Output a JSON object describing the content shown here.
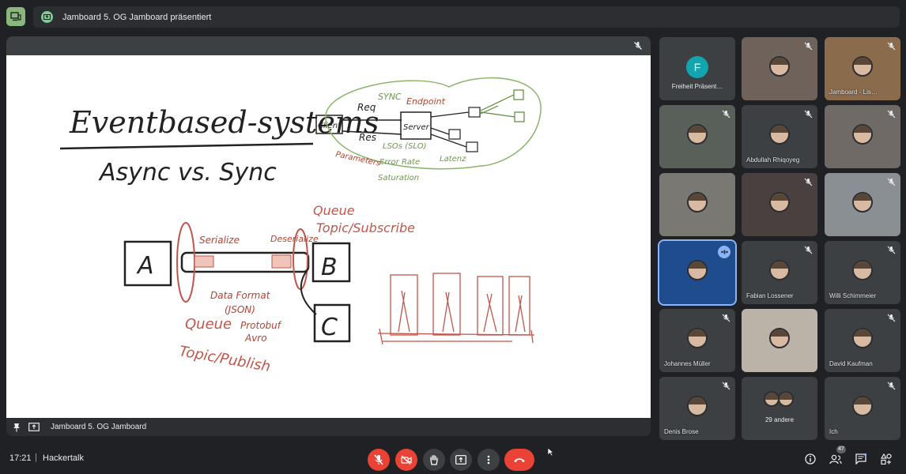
{
  "banner": {
    "text": "Jamboard 5. OG Jamboard präsentiert"
  },
  "presentation": {
    "footer_text": "Jamboard 5. OG Jamboard",
    "whiteboard": {
      "title": "Eventbased-systems",
      "subtitle": "Async vs. Sync",
      "client_label": "Client",
      "server_label": "Server",
      "req_label": "Req",
      "res_label": "Res",
      "sync_label": "SYNC",
      "endpoint_label": "Endpoint",
      "parameters_label": "Parameters",
      "metrics": [
        "LSOs (SLO)",
        "Latenz",
        "Error Rate",
        "Saturation"
      ],
      "box_a": "A",
      "box_b": "B",
      "box_c": "C",
      "serialize_label": "Serialize",
      "deserialize_label": "Deserialize",
      "queue_topic_sub": [
        "Queue",
        "Topic/Subscribe"
      ],
      "dataformat": [
        "Data Format",
        "(JSON)",
        "Protobuf",
        "Avro"
      ],
      "queue_topic_pub": [
        "Queue",
        "Topic/Publish"
      ]
    }
  },
  "participants": [
    {
      "id": "freiheit",
      "name": "Freiheit Präsent…",
      "avatar_letter": "F",
      "muted": false
    },
    {
      "id": "p2",
      "name": "",
      "muted": true
    },
    {
      "id": "jamboard-lis",
      "name": "Jamboard - Lis…",
      "muted": true
    },
    {
      "id": "p4",
      "name": "",
      "muted": true
    },
    {
      "id": "abdullah",
      "name": "Abdullah Rhiqoyeg",
      "muted": true
    },
    {
      "id": "p6",
      "name": "",
      "muted": true
    },
    {
      "id": "p7",
      "name": "",
      "muted": false
    },
    {
      "id": "p8",
      "name": "",
      "muted": true
    },
    {
      "id": "p9",
      "name": "",
      "muted": true
    },
    {
      "id": "p10",
      "name": "",
      "muted": false,
      "speaking": true
    },
    {
      "id": "fabian",
      "name": "Fabian Lossener",
      "muted": true
    },
    {
      "id": "willi",
      "name": "Willi Schimmeier",
      "muted": true
    },
    {
      "id": "johannes",
      "name": "Johannes Müller",
      "muted": true
    },
    {
      "id": "p14",
      "name": "",
      "muted": false
    },
    {
      "id": "david",
      "name": "David Kaufman",
      "muted": true
    },
    {
      "id": "dennis",
      "name": "Denis Brose",
      "muted": true
    },
    {
      "id": "others",
      "name": "29 andere",
      "muted": false
    },
    {
      "id": "me",
      "name": "Ich",
      "muted": true
    }
  ],
  "bottombar": {
    "time": "17:21",
    "separator": "|",
    "meeting_name": "Hackertalk",
    "participant_count": "47"
  },
  "icons": {
    "mic": "mic-off-icon",
    "camera": "camera-off-icon",
    "hand": "raise-hand-icon",
    "present": "present-screen-icon",
    "more": "more-vert-icon",
    "hangup": "hang-up-icon",
    "info": "info-icon",
    "people": "people-icon",
    "chat": "chat-icon",
    "activities": "activities-icon"
  },
  "colors": {
    "accent_red": "#ea4335",
    "presenter_green": "#81c995",
    "avatar_teal": "#12a4af",
    "speaking_blue": "#8ab4f8"
  }
}
